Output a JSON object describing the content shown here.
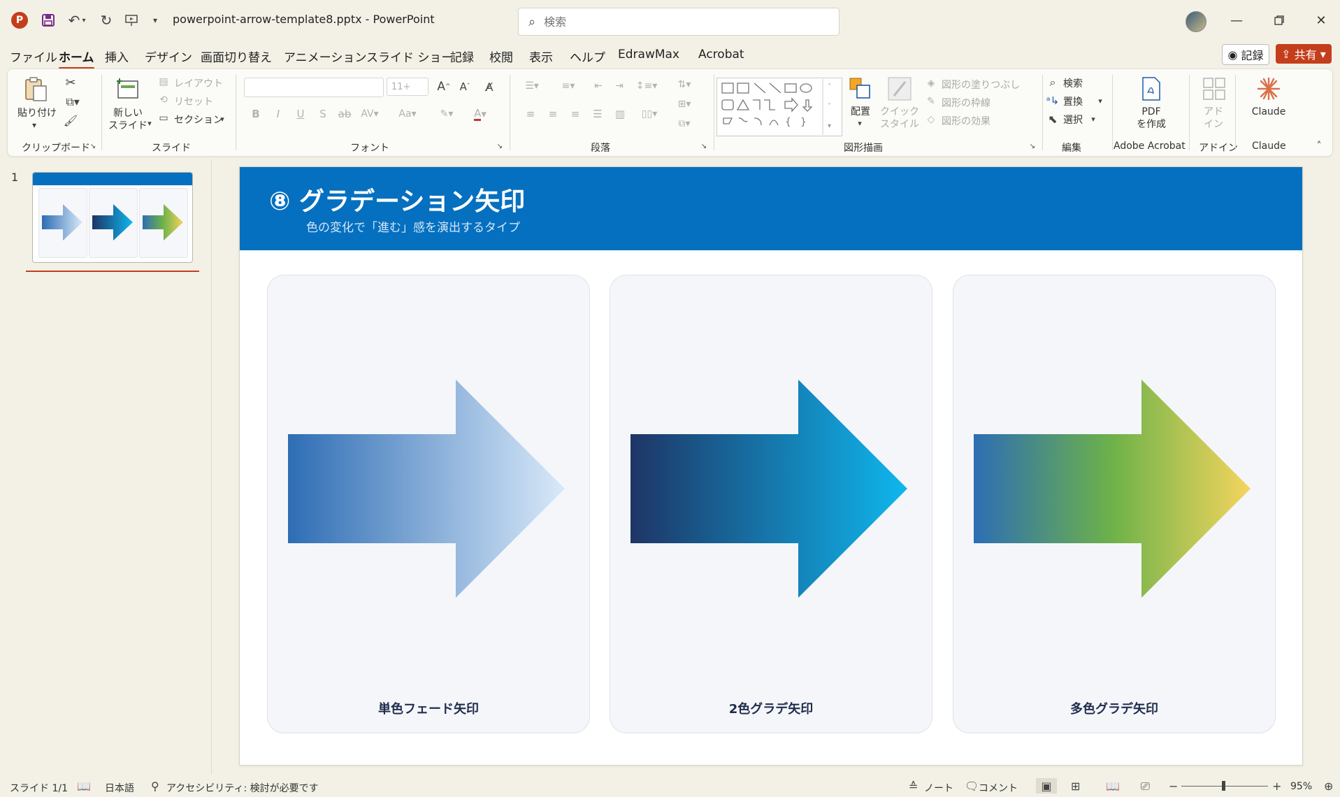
{
  "app": {
    "title": "powerpoint-arrow-template8.pptx  -  PowerPoint",
    "search_placeholder": "検索",
    "logo_letter": "P"
  },
  "tabs": [
    "ファイル",
    "ホーム",
    "挿入",
    "デザイン",
    "画面切り替え",
    "アニメーション",
    "スライド ショー",
    "記録",
    "校閲",
    "表示",
    "ヘルプ",
    "EdrawMax",
    "Acrobat"
  ],
  "active_tab": "ホーム",
  "header_buttons": {
    "record": "記録",
    "share": "共有"
  },
  "ribbon": {
    "groups": [
      "クリップボード",
      "スライド",
      "フォント",
      "段落",
      "図形描画",
      "編集",
      "Adobe Acrobat",
      "アドイン",
      "Claude"
    ],
    "paste": "貼り付け",
    "new_slide": "新しい\nスライド",
    "layout": "レイアウト",
    "reset": "リセット",
    "section": "セクション",
    "font_size": "11+",
    "arrange": "配置",
    "quick_style": "クイック\nスタイル",
    "shape_fill": "図形の塗りつぶし",
    "shape_outline": "図形の枠線",
    "shape_effects": "図形の効果",
    "find": "検索",
    "replace": "置換",
    "select": "選択",
    "pdf": "PDF\nを作成",
    "addin": "アド\nイン",
    "claude": "Claude"
  },
  "thumbnails": [
    {
      "number": "1"
    }
  ],
  "slide": {
    "title": "⑧ グラデーション矢印",
    "subtitle": "色の変化で「進む」感を演出するタイプ",
    "cards": [
      {
        "label": "単色フェード矢印",
        "stops": [
          "#2e6db4",
          "#d9e9f9"
        ]
      },
      {
        "label": "2色グラデ矢印",
        "stops": [
          "#1e3566",
          "#0eb7ee"
        ]
      },
      {
        "label": "多色グラデ矢印",
        "stops": [
          "#2d6eb4",
          "#6db249",
          "#f4d55e"
        ]
      }
    ]
  },
  "status": {
    "slide": "スライド 1/1",
    "language": "日本語",
    "accessibility": "アクセシビリティ: 検討が必要です",
    "notes": "ノート",
    "comments": "コメント",
    "zoom": "95%"
  },
  "colors": {
    "accent": "#c43e1c",
    "slide_header": "#0570c0"
  }
}
